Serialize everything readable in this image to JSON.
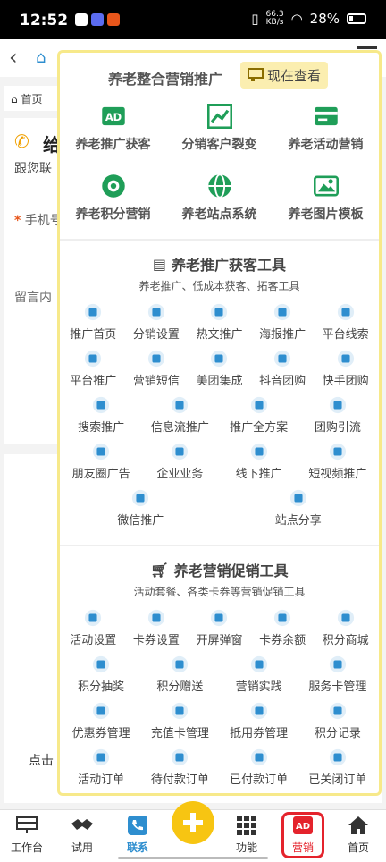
{
  "status_bar": {
    "time": "12:52",
    "net_speed": "66.3",
    "net_unit": "KB/s",
    "battery": "28%"
  },
  "page": {
    "breadcrumb_home": "首页",
    "card_title": "给",
    "card_sub": "跟您联",
    "field_phone": "手机号",
    "field_message": "留言内",
    "click_text": "点击"
  },
  "panel": {
    "top_title": "养老整合营销推广",
    "now_button": "现在查看",
    "top_items": [
      {
        "label": "养老推广获客",
        "icon": "ad-icon"
      },
      {
        "label": "分销客户裂变",
        "icon": "trending-icon"
      },
      {
        "label": "养老活动营销",
        "icon": "card-icon"
      },
      {
        "label": "养老积分营销",
        "icon": "disc-icon"
      },
      {
        "label": "养老站点系统",
        "icon": "globe-icon"
      },
      {
        "label": "养老图片模板",
        "icon": "image-icon"
      }
    ],
    "tools": {
      "title": "养老推广获客工具",
      "subtitle": "养老推广、低成本获客、拓客工具",
      "items": [
        "推广首页",
        "分销设置",
        "热文推广",
        "海报推广",
        "平台线索",
        "平台推广",
        "营销短信",
        "美团集成",
        "抖音团购",
        "快手团购",
        "搜索推广",
        "信息流推广",
        "推广全方案",
        "团购引流",
        "朋友圈广告",
        "企业业务",
        "线下推广",
        "短视频推广",
        "微信推广",
        "站点分享"
      ]
    },
    "promo": {
      "title": "养老营销促销工具",
      "subtitle": "活动套餐、各类卡券等营销促销工具",
      "items": [
        "活动设置",
        "卡券设置",
        "开屏弹窗",
        "卡券余额",
        "积分商城",
        "积分抽奖",
        "积分赠送",
        "营销实践",
        "服务卡管理",
        "优惠券管理",
        "充值卡管理",
        "抵用券管理",
        "积分记录",
        "活动订单",
        "待付款订单",
        "已付款订单",
        "已关闭订单"
      ]
    }
  },
  "bottom_nav": {
    "workbench": "工作台",
    "trial": "试用",
    "contact": "联系",
    "features": "功能",
    "marketing": "营销",
    "home": "首页"
  },
  "colors": {
    "green": "#1f9e58",
    "blue": "#2e8ecf",
    "yellow": "#f7c512",
    "highlight_red": "#e4232c"
  }
}
